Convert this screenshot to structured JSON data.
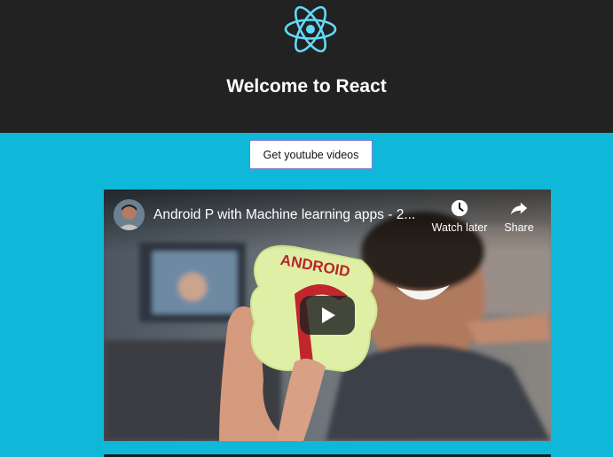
{
  "header": {
    "logo_icon": "react-atom-icon",
    "logo_color": "#61dafb",
    "title": "Welcome to React",
    "background": "#222222"
  },
  "main": {
    "background": "#0fb8d8",
    "fetch_button_label": "Get youtube videos"
  },
  "video": {
    "title": "Android P with Machine learning apps - 2...",
    "watch_later_label": "Watch later",
    "share_label": "Share",
    "icons": {
      "watch_later": "clock-icon",
      "share": "share-arrow-icon",
      "play": "play-icon"
    },
    "thumbnail_text": "ANDROID"
  }
}
